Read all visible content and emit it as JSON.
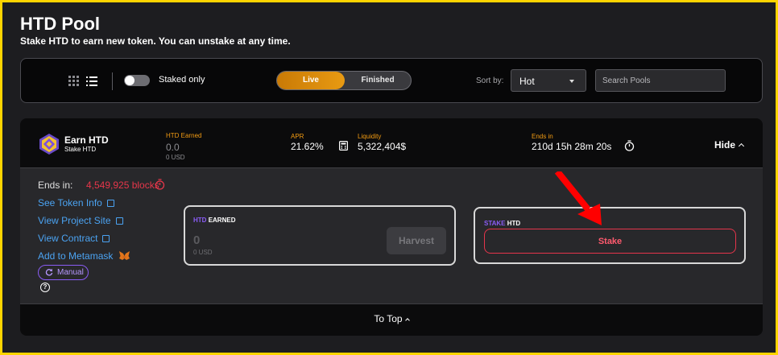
{
  "header": {
    "title": "HTD Pool",
    "subtitle": "Stake HTD to earn new token. You can unstake at any time."
  },
  "toolbar": {
    "view_icons": [
      "grid-view-icon",
      "list-view-icon"
    ],
    "staked_only_label": "Staked only",
    "staked_only_on": false,
    "live_label": "Live",
    "finished_label": "Finished",
    "sort_label": "Sort by:",
    "sort_value": "Hot",
    "search_placeholder": "Search Pools"
  },
  "pool": {
    "title": "Earn HTD",
    "subtitle": "Stake HTD",
    "htd_earned_label": "HTD Earned",
    "htd_earned_value": "0.0",
    "htd_earned_usd": "0 USD",
    "apr_label": "APR",
    "apr_value": "21.62%",
    "liquidity_label": "Liquidity",
    "liquidity_value": "5,322,404$",
    "ends_label": "Ends in",
    "ends_value": "210d 15h 28m 20s",
    "hide_label": "Hide",
    "details": {
      "ends_in_label": "Ends in:",
      "ends_in_value": "4,549,925 blocks",
      "links": [
        "See Token Info",
        "View Project Site",
        "View Contract",
        "Add to Metamask"
      ],
      "manual_label": "Manual",
      "help": "?"
    },
    "earned_panel": {
      "token": "HTD",
      "label": "EARNED",
      "value": "0",
      "usd": "0 USD",
      "harvest_label": "Harvest"
    },
    "stake_panel": {
      "label_prefix": "STAKE",
      "token": "HTD",
      "stake_label": "Stake"
    },
    "to_top_label": "To Top"
  },
  "colors": {
    "frame": "#ffd400",
    "accent_orange": "#f29b12",
    "link_blue": "#4ba3f2",
    "danger_red": "#e6364a",
    "manual_purple": "#8a5cf5",
    "annotation_arrow": "#ff0000"
  }
}
